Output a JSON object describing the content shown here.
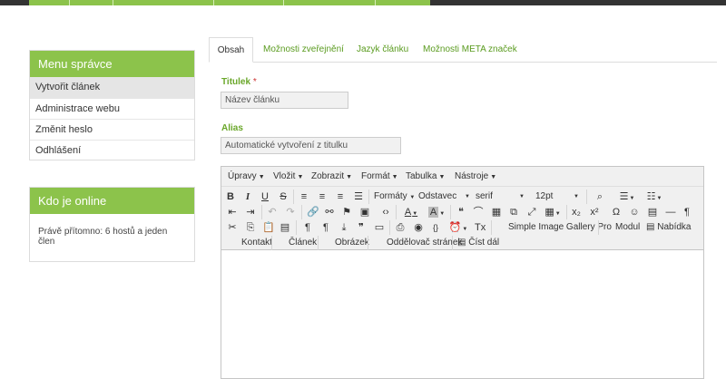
{
  "sidebar": {
    "menu": {
      "title": "Menu správce",
      "items": [
        "Vytvořit článek",
        "Administrace webu",
        "Změnit heslo",
        "Odhlášení"
      ]
    },
    "online": {
      "title": "Kdo je online",
      "text": "Právě přítomno: 6 hostů a jeden člen"
    }
  },
  "tabs": [
    "Obsah",
    "Možnosti zveřejnění",
    "Jazyk článku",
    "Možnosti META značek"
  ],
  "form": {
    "title_label": "Titulek",
    "required_mark": "*",
    "title_placeholder": "Název článku",
    "alias_label": "Alias",
    "alias_placeholder": "Automatické vytvoření z titulku"
  },
  "editor": {
    "menubar": [
      "Úpravy",
      "Vložit",
      "Zobrazit",
      "Formát",
      "Tabulka",
      "Nástroje"
    ],
    "formats_label": "Formáty",
    "block_label": "Odstavec",
    "font_label": "serif",
    "size_label": "12pt",
    "gallery_button": "Simple Image Gallery Pro",
    "module_button": "Modul",
    "menu_button": "Nabídka",
    "contact_button": "Kontakt",
    "article_button": "Článek",
    "image_button": "Obrázek",
    "pagebreak_button": "Oddělovač stránek",
    "readmore_button": "Číst dál"
  },
  "colors": {
    "accent": "#8cc34b",
    "link": "#5a9b1f",
    "topbar": "#333333"
  }
}
